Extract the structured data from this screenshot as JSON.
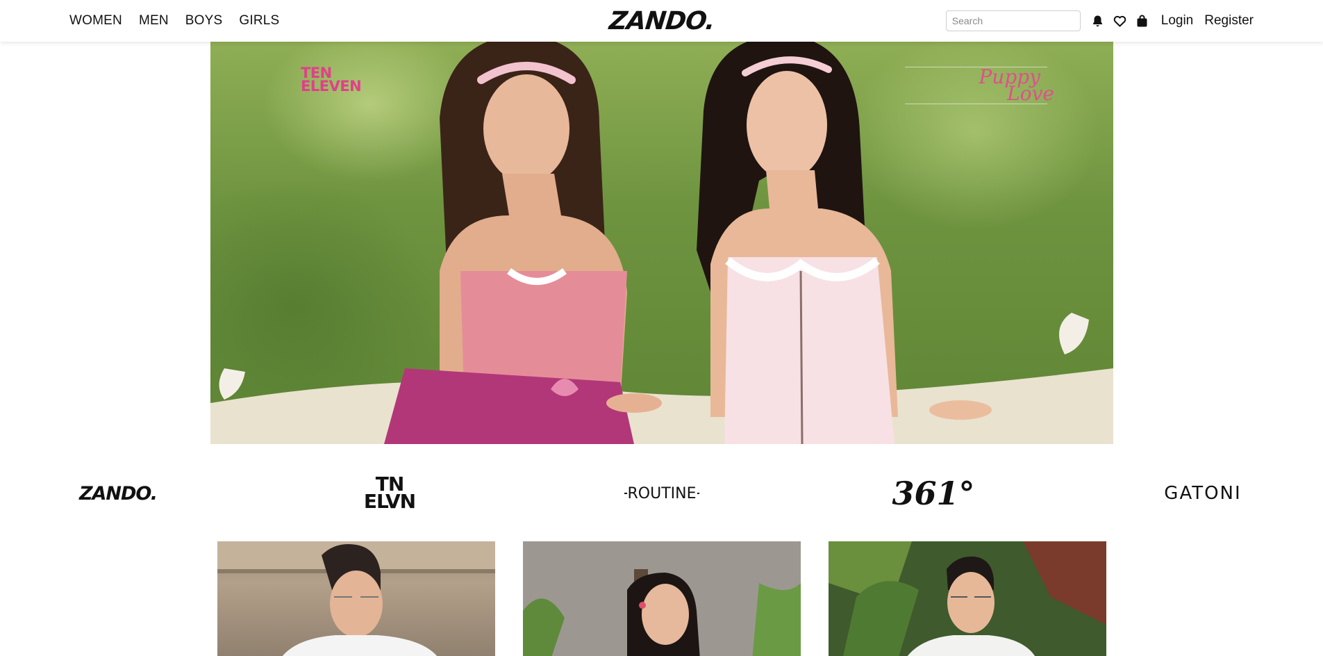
{
  "header": {
    "nav": [
      "WOMEN",
      "MEN",
      "BOYS",
      "GIRLS"
    ],
    "logo": "ZANDO.",
    "search": {
      "placeholder": "Search",
      "value": ""
    },
    "icons": [
      "bell-icon",
      "heart-icon",
      "shopping-bag-icon"
    ],
    "login": "Login",
    "register": "Register"
  },
  "hero": {
    "brand_left_line1": "TEN",
    "brand_left_line2": "ELEVEN",
    "brand_right_line1": "Puppy",
    "brand_right_line2": "Love"
  },
  "brands": {
    "zando": "ZANDO.",
    "tnelvn_line1": "TN",
    "tnelvn_line2": "ELVN",
    "routine": "ROUTINE",
    "three61": "361°",
    "gatoni": "GATONI"
  },
  "colors": {
    "brand_pink": "#e0408a",
    "text": "#111111"
  }
}
